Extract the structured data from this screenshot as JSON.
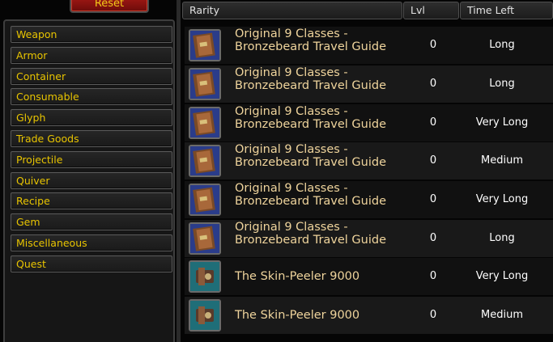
{
  "reset_label": "Reset",
  "categories": [
    "Weapon",
    "Armor",
    "Container",
    "Consumable",
    "Glyph",
    "Trade Goods",
    "Projectile",
    "Quiver",
    "Recipe",
    "Gem",
    "Miscellaneous",
    "Quest"
  ],
  "columns": {
    "rarity": "Rarity",
    "lvl": "Lvl",
    "time_left": "Time Left"
  },
  "items": [
    {
      "name_line1": "Original 9 Classes -",
      "name_line2": "Bronzebeard Travel Guide",
      "icon": "book-icon",
      "lvl": "0",
      "time": "Long"
    },
    {
      "name_line1": "Original 9 Classes -",
      "name_line2": "Bronzebeard Travel Guide",
      "icon": "book-icon",
      "lvl": "0",
      "time": "Long"
    },
    {
      "name_line1": "Original 9 Classes -",
      "name_line2": "Bronzebeard Travel Guide",
      "icon": "book-icon",
      "lvl": "0",
      "time": "Very Long"
    },
    {
      "name_line1": "Original 9 Classes -",
      "name_line2": "Bronzebeard Travel Guide",
      "icon": "book-icon",
      "lvl": "0",
      "time": "Medium"
    },
    {
      "name_line1": "Original 9 Classes -",
      "name_line2": "Bronzebeard Travel Guide",
      "icon": "book-icon",
      "lvl": "0",
      "time": "Very Long"
    },
    {
      "name_line1": "Original 9 Classes -",
      "name_line2": "Bronzebeard Travel Guide",
      "icon": "book-icon",
      "lvl": "0",
      "time": "Long"
    },
    {
      "name_line1": "The Skin-Peeler 9000",
      "name_line2": "",
      "icon": "gadget-icon",
      "lvl": "0",
      "time": "Very Long"
    },
    {
      "name_line1": "The Skin-Peeler 9000",
      "name_line2": "",
      "icon": "gadget-icon",
      "lvl": "0",
      "time": "Medium"
    }
  ],
  "colors": {
    "category_text": "#e8c400",
    "item_name": "#efd49c",
    "reset_bg": "#a81a16"
  }
}
